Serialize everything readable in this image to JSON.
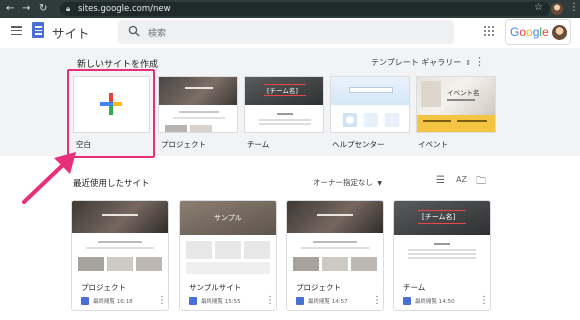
{
  "browser": {
    "back_icon": "arrow-left-icon",
    "forward_icon": "arrow-right-icon",
    "reload_icon": "reload-icon",
    "url": "sites.google.com/new"
  },
  "header": {
    "app_title": "サイト",
    "search_placeholder": "検索",
    "google_text": "Google"
  },
  "start": {
    "title": "新しいサイトを作成",
    "gallery_label": "テンプレート ギャラリー",
    "blank_label": "空白",
    "templates": [
      {
        "label": "プロジェクト"
      },
      {
        "label": "チーム",
        "banner": "[チーム名]"
      },
      {
        "label": "ヘルプセンター"
      },
      {
        "label": "イベント",
        "banner": "イベント名"
      }
    ]
  },
  "recent": {
    "title": "最近使用したサイト",
    "owner_filter": "オーナー指定なし",
    "cards": [
      {
        "name": "プロジェクト",
        "meta": "最終閲覧 16:18"
      },
      {
        "name": "サンプルサイト",
        "meta": "最終閲覧 15:55",
        "banner": "サンプル"
      },
      {
        "name": "プロジェクト",
        "meta": "最終閲覧 14:57"
      },
      {
        "name": "チーム",
        "meta": "最終閲覧 14:50",
        "banner": "[チーム名]"
      }
    ]
  },
  "colors": {
    "highlight": "#e8307a",
    "sites_blue": "#4a6fd6",
    "chrome_bar": "#2f3b3b"
  }
}
